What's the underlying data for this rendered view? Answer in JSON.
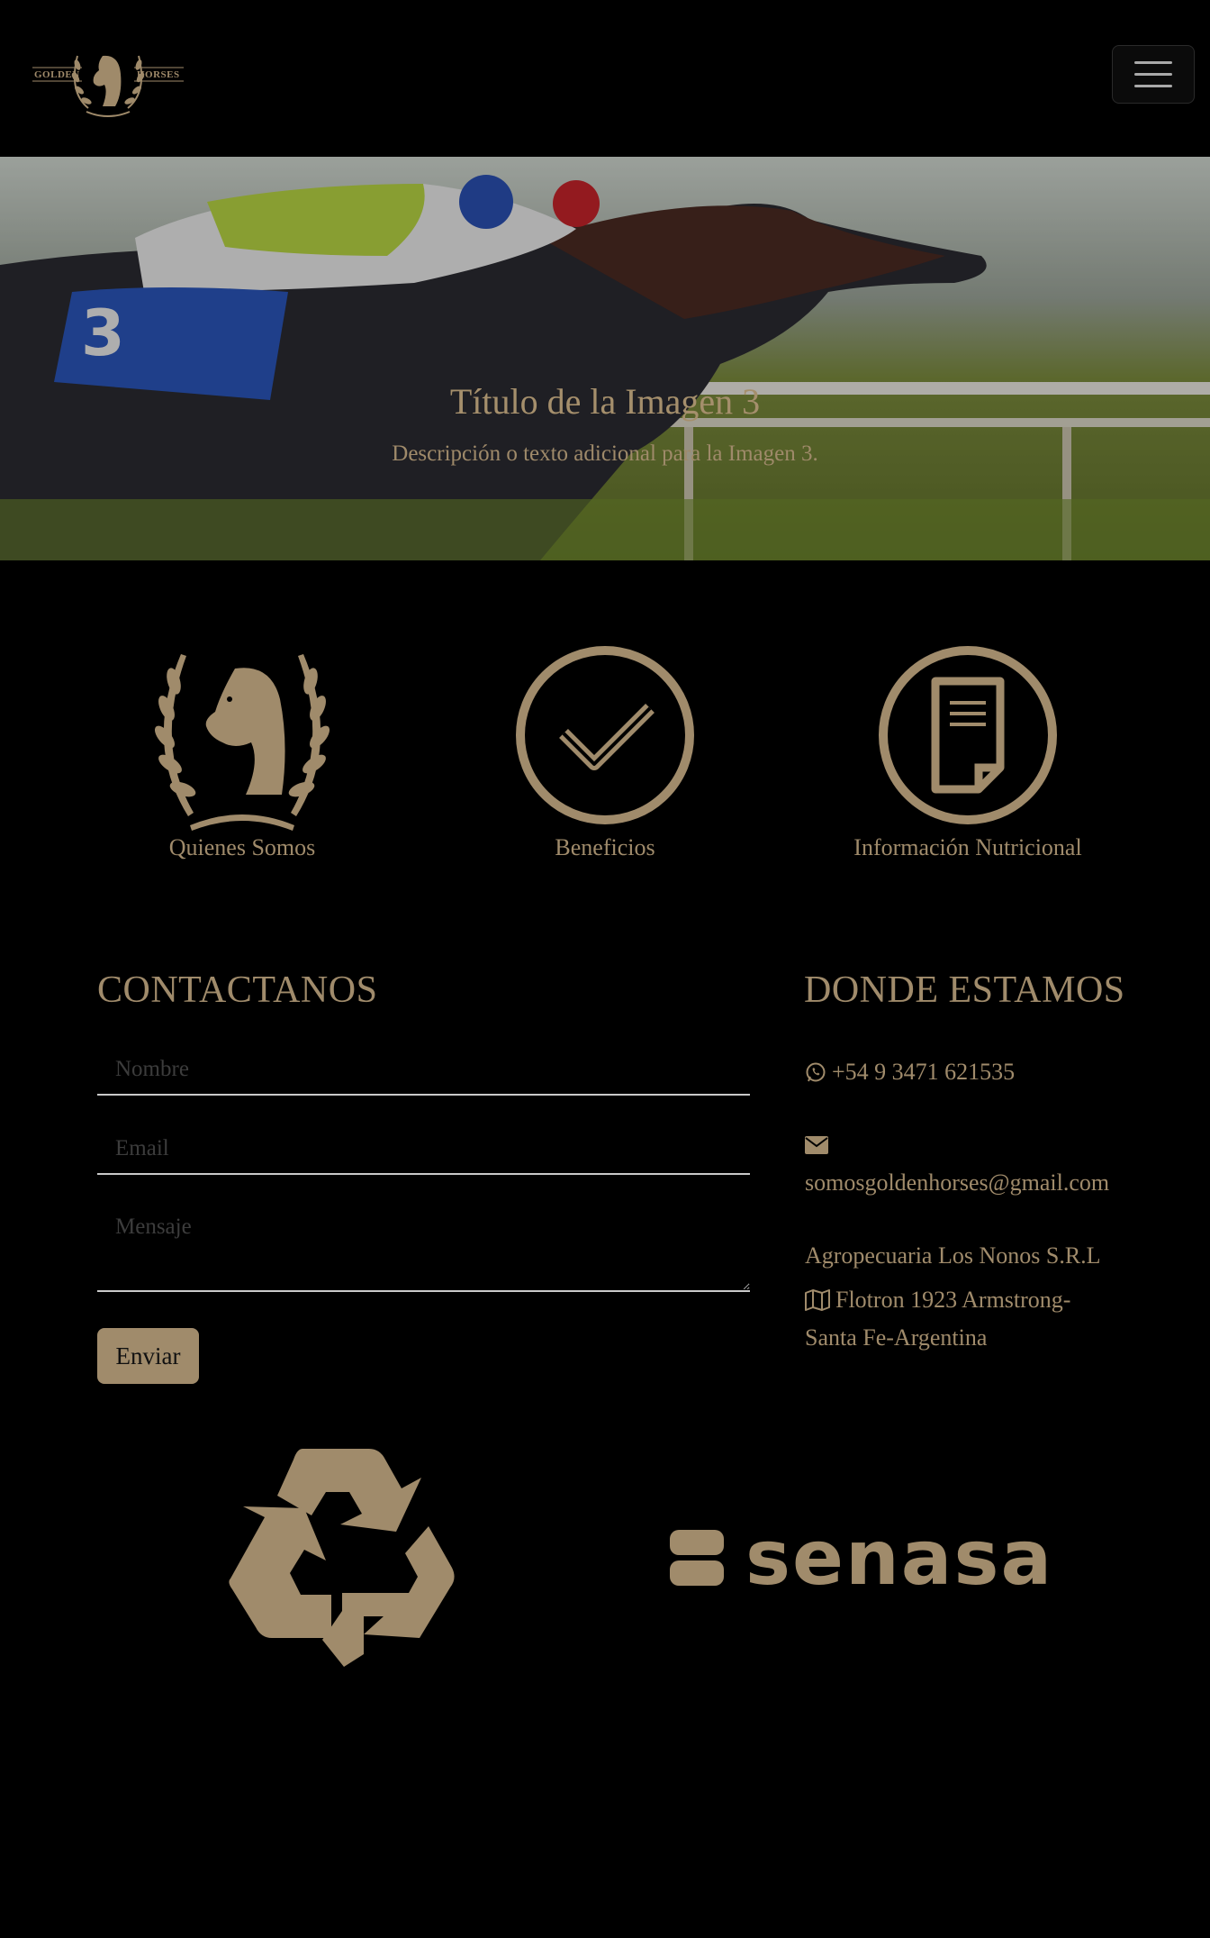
{
  "header": {
    "logo_left": "GOLDEN",
    "logo_right": "HORSES",
    "menu_icon": "hamburger-icon"
  },
  "hero": {
    "title": "Título de la Imagen 3",
    "description": "Descripción o texto adicional para la Imagen 3."
  },
  "features": [
    {
      "label": "Quienes Somos",
      "icon": "horse-laurel-icon"
    },
    {
      "label": "Beneficios",
      "icon": "checkmark-circle-icon"
    },
    {
      "label": "Información Nutricional",
      "icon": "document-circle-icon"
    }
  ],
  "contact": {
    "title": "CONTACTANOS",
    "name_placeholder": "Nombre",
    "email_placeholder": "Email",
    "message_placeholder": "Mensaje",
    "send_label": "Enviar"
  },
  "location": {
    "title": "DONDE ESTAMOS",
    "phone": "+54 9 3471 621535",
    "email": "somosgoldenhorses@gmail.com",
    "company": "Agropecuaria Los Nonos S.R.L",
    "address_line1": "Flotron 1923 Armstrong-",
    "address_line2": "Santa Fe-Argentina"
  },
  "footer_logos": {
    "recycle": "recycle-icon",
    "senasa": "senasa"
  },
  "colors": {
    "background": "#000000",
    "accent": "#a08b6b"
  }
}
